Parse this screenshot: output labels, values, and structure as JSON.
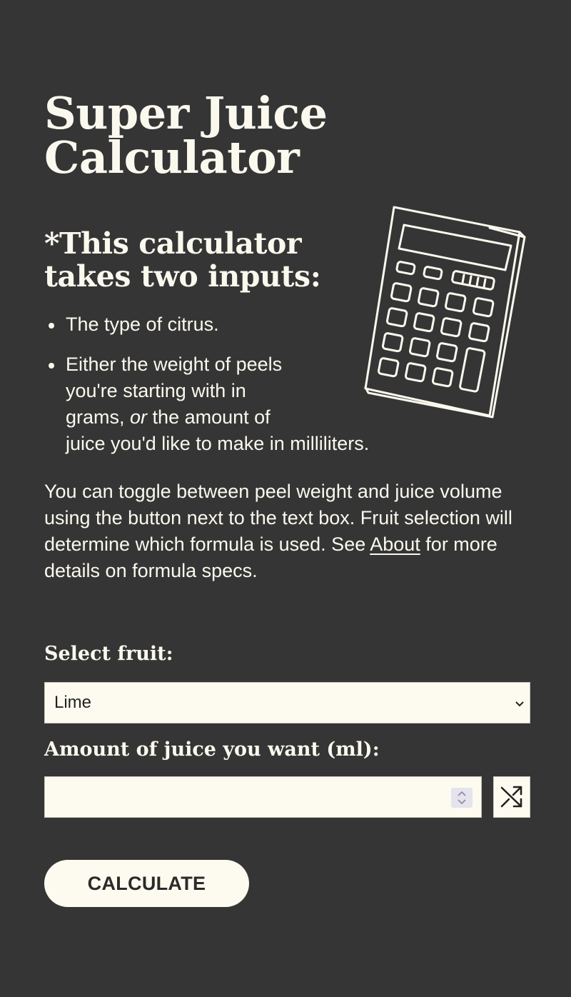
{
  "header": {
    "title_line1": "Super Juice",
    "title_line2": "Calculator"
  },
  "intro": {
    "heading_line1": "*This calculator",
    "heading_line2": "takes two inputs:",
    "items": [
      {
        "line1": "The type of citrus."
      },
      {
        "line1": "Either the weight of peels",
        "line2": "you're starting with in",
        "line3_pre": "grams, ",
        "line3_or": "or",
        "line3_post": " the amount of",
        "line4": "juice you'd like to make in milliliters."
      }
    ],
    "description_before_link": "You can toggle between peel weight and juice volume using the button next to the text box. Fruit selection will determine which formula is used. See ",
    "link_text": "About",
    "description_after_link": " for more details on formula specs."
  },
  "form": {
    "fruit_label": "Select fruit:",
    "fruit_selected": "Lime",
    "amount_label": "Amount of juice you want (ml):",
    "amount_value": "",
    "calculate_label": "CALCULATE"
  },
  "icons": {
    "illustration": "calculator-illustration",
    "toggle": "shuffle-icon",
    "dropdown": "chevron-down-icon",
    "spinner": "spinner-icon"
  },
  "colors": {
    "background": "#353535",
    "text": "#fbf9ee",
    "field_background": "#fdfbef",
    "button_text": "#2a2a2a"
  }
}
